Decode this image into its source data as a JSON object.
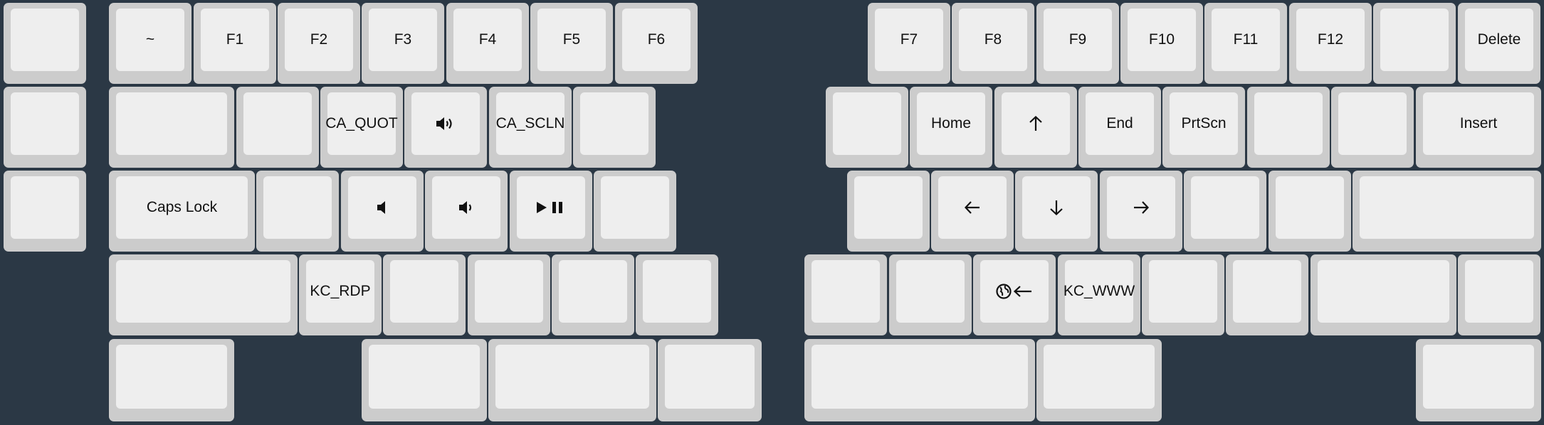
{
  "colors": {
    "background": "#2b3845",
    "key_base": "#cccccc",
    "key_top": "#eeeeee",
    "legend": "#111111"
  },
  "left_half": {
    "thumb_column": [
      {
        "label": ""
      },
      {
        "label": ""
      },
      {
        "label": ""
      }
    ],
    "rows": [
      [
        {
          "label": "~"
        },
        {
          "label": "F1"
        },
        {
          "label": "F2"
        },
        {
          "label": "F3"
        },
        {
          "label": "F4"
        },
        {
          "label": "F5"
        },
        {
          "label": "F6"
        }
      ],
      [
        {
          "label": ""
        },
        {
          "label": ""
        },
        {
          "label": "CA_QUOT"
        },
        {
          "label": "",
          "icon": "volume-up-icon"
        },
        {
          "label": "CA_SCLN"
        },
        {
          "label": ""
        }
      ],
      [
        {
          "label": "Caps Lock"
        },
        {
          "label": ""
        },
        {
          "label": "",
          "icon": "volume-mute-icon"
        },
        {
          "label": "",
          "icon": "volume-down-icon"
        },
        {
          "label": "",
          "icon": "play-pause-icon"
        },
        {
          "label": ""
        }
      ],
      [
        {
          "label": ""
        },
        {
          "label": "KC_RDP"
        },
        {
          "label": ""
        },
        {
          "label": ""
        },
        {
          "label": ""
        },
        {
          "label": ""
        }
      ],
      [
        {
          "label": ""
        },
        {
          "label": ""
        },
        {
          "label": ""
        },
        {
          "label": ""
        }
      ]
    ]
  },
  "right_half": {
    "rows": [
      [
        {
          "label": "F7"
        },
        {
          "label": "F8"
        },
        {
          "label": "F9"
        },
        {
          "label": "F10"
        },
        {
          "label": "F11"
        },
        {
          "label": "F12"
        },
        {
          "label": ""
        },
        {
          "label": "Delete"
        }
      ],
      [
        {
          "label": ""
        },
        {
          "label": "Home"
        },
        {
          "label": "",
          "icon": "arrow-up-icon"
        },
        {
          "label": "End"
        },
        {
          "label": "PrtScn"
        },
        {
          "label": ""
        },
        {
          "label": ""
        },
        {
          "label": "Insert"
        }
      ],
      [
        {
          "label": ""
        },
        {
          "label": "",
          "icon": "arrow-left-icon"
        },
        {
          "label": "",
          "icon": "arrow-down-icon"
        },
        {
          "label": "",
          "icon": "arrow-right-icon"
        },
        {
          "label": ""
        },
        {
          "label": ""
        },
        {
          "label": ""
        }
      ],
      [
        {
          "label": ""
        },
        {
          "label": ""
        },
        {
          "label": "",
          "icon": "browser-back-icon"
        },
        {
          "label": "KC_WWW"
        },
        {
          "label": ""
        },
        {
          "label": ""
        },
        {
          "label": ""
        },
        {
          "label": ""
        }
      ],
      [
        {
          "label": ""
        },
        {
          "label": ""
        },
        {
          "label": ""
        }
      ]
    ]
  }
}
